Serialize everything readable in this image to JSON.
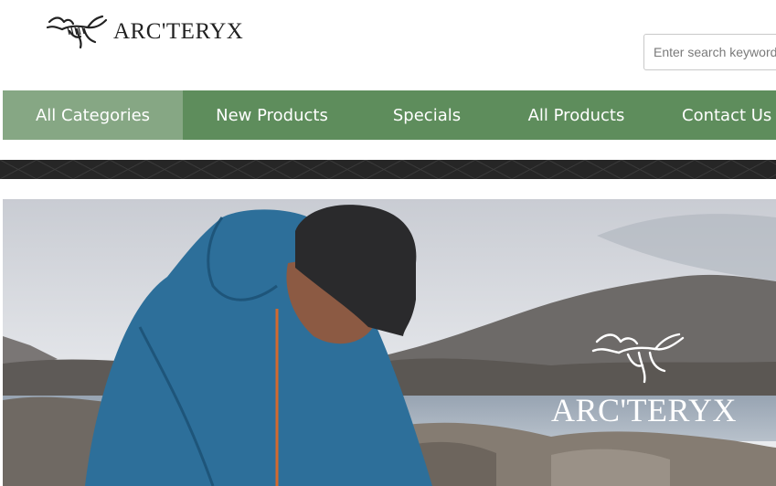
{
  "brand": {
    "logo_text": "ARC'TERYX",
    "hero_logo_text": "ARC'TERYX"
  },
  "search": {
    "placeholder": "Enter search keywords here"
  },
  "nav": {
    "items": [
      {
        "label": "All Categories",
        "active": true
      },
      {
        "label": "New Products"
      },
      {
        "label": "Specials"
      },
      {
        "label": "All Products"
      },
      {
        "label": "Contact Us"
      }
    ]
  },
  "colors": {
    "nav_bg": "#5e8d5c",
    "nav_active_bg": "#86a784",
    "band_bg": "#262626",
    "jacket": "#2d6f9a"
  },
  "icons": {
    "brand_logo": "archaeopteryx-icon"
  }
}
